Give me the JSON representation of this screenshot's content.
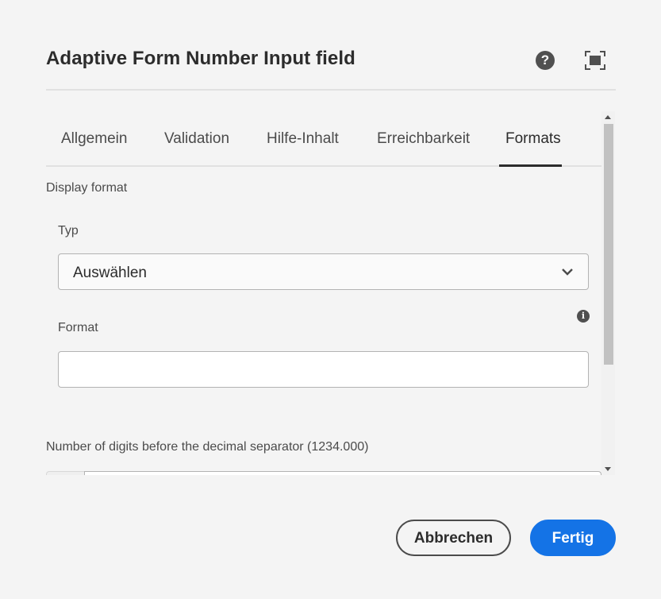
{
  "dialog": {
    "title": "Adaptive Form Number Input field",
    "help_icon": "help-icon",
    "fullscreen_icon": "fullscreen-icon"
  },
  "tabs": [
    {
      "label": "Allgemein",
      "active": false
    },
    {
      "label": "Validation",
      "active": false
    },
    {
      "label": "Hilfe-Inhalt",
      "active": false
    },
    {
      "label": "Erreichbarkeit",
      "active": false
    },
    {
      "label": "Formats",
      "active": true
    }
  ],
  "formats": {
    "section_label": "Display format",
    "type_label": "Typ",
    "type_value": "Auswählen",
    "format_label": "Format",
    "format_value": "",
    "format_info_icon": "info-icon",
    "digits_label": "Number of digits before the decimal separator (1234.000)"
  },
  "footer": {
    "cancel_label": "Abbrechen",
    "done_label": "Fertig"
  },
  "colors": {
    "primary": "#1473e6",
    "background": "#f4f4f4",
    "text": "#2c2c2c"
  }
}
